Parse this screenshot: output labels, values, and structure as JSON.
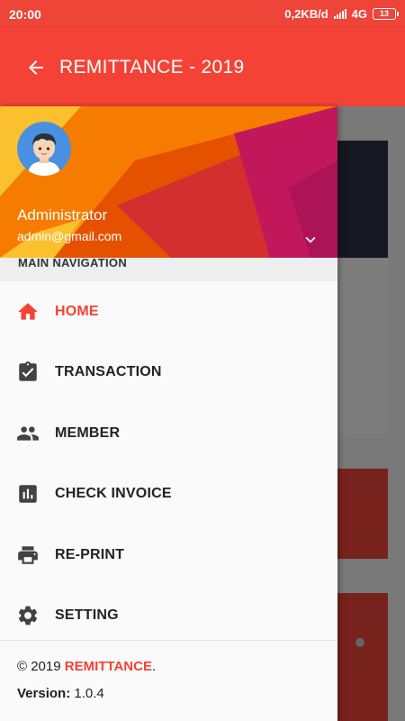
{
  "status_bar": {
    "time": "20:00",
    "net_speed": "0,2KB/d",
    "network": "4G",
    "battery": "13"
  },
  "app_bar": {
    "title": "REMITTANCE - 2019",
    "back_icon": "arrow-back-icon",
    "color": "#f44336"
  },
  "drawer": {
    "user": {
      "name": "Administrator",
      "email": "admin@gmail.com",
      "avatar_icon": "avatar-icon",
      "expand_icon": "chevron-down-icon"
    },
    "section_label": "MAIN NAVIGATION",
    "items": [
      {
        "label": "HOME",
        "icon": "home-icon",
        "active": true
      },
      {
        "label": "TRANSACTION",
        "icon": "clipboard-check-icon",
        "active": false
      },
      {
        "label": "MEMBER",
        "icon": "people-icon",
        "active": false
      },
      {
        "label": "CHECK INVOICE",
        "icon": "bar-chart-icon",
        "active": false
      },
      {
        "label": "RE-PRINT",
        "icon": "printer-icon",
        "active": false
      },
      {
        "label": "SETTING",
        "icon": "gear-icon",
        "active": false
      }
    ],
    "footer": {
      "copyright_prefix": "© 2019 ",
      "brand": "REMITTANCE",
      "suffix": ".",
      "version_label": "Version:",
      "version_value": " 1.0.4"
    }
  },
  "colors": {
    "accent": "#f44336",
    "text": "#222222"
  }
}
